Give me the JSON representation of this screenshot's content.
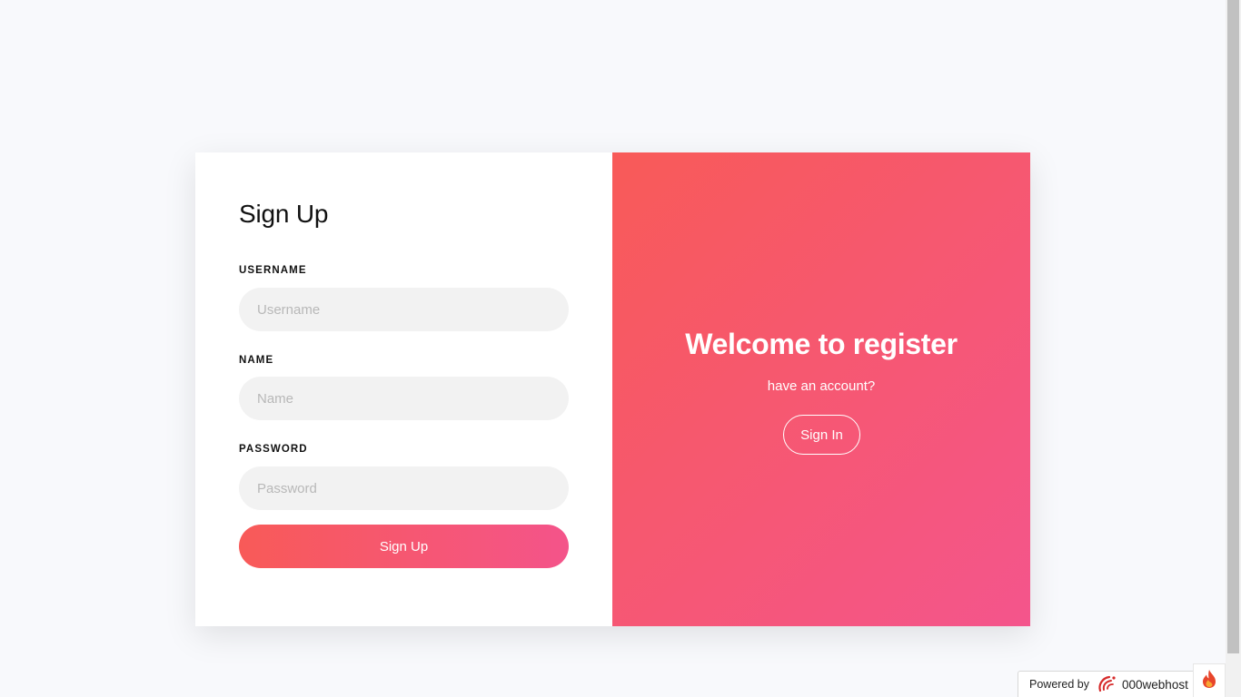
{
  "form": {
    "title": "Sign Up",
    "username_label": "USERNAME",
    "username_placeholder": "Username",
    "username_value": "",
    "name_label": "NAME",
    "name_placeholder": "Name",
    "name_value": "",
    "password_label": "PASSWORD",
    "password_placeholder": "Password",
    "password_value": "",
    "submit_label": "Sign Up"
  },
  "panel": {
    "heading": "Welcome to register",
    "subtext": "have an account?",
    "signin_label": "Sign In"
  },
  "footer": {
    "powered_prefix": "Powered by",
    "brand": "000webhost",
    "logo_icon": "000webhost-logo-icon",
    "fire_icon": "fire-icon"
  },
  "colors": {
    "page_background": "#f8f9fc",
    "gradient_start": "#f85a58",
    "gradient_end": "#f4558c",
    "input_background": "#f2f2f2"
  }
}
